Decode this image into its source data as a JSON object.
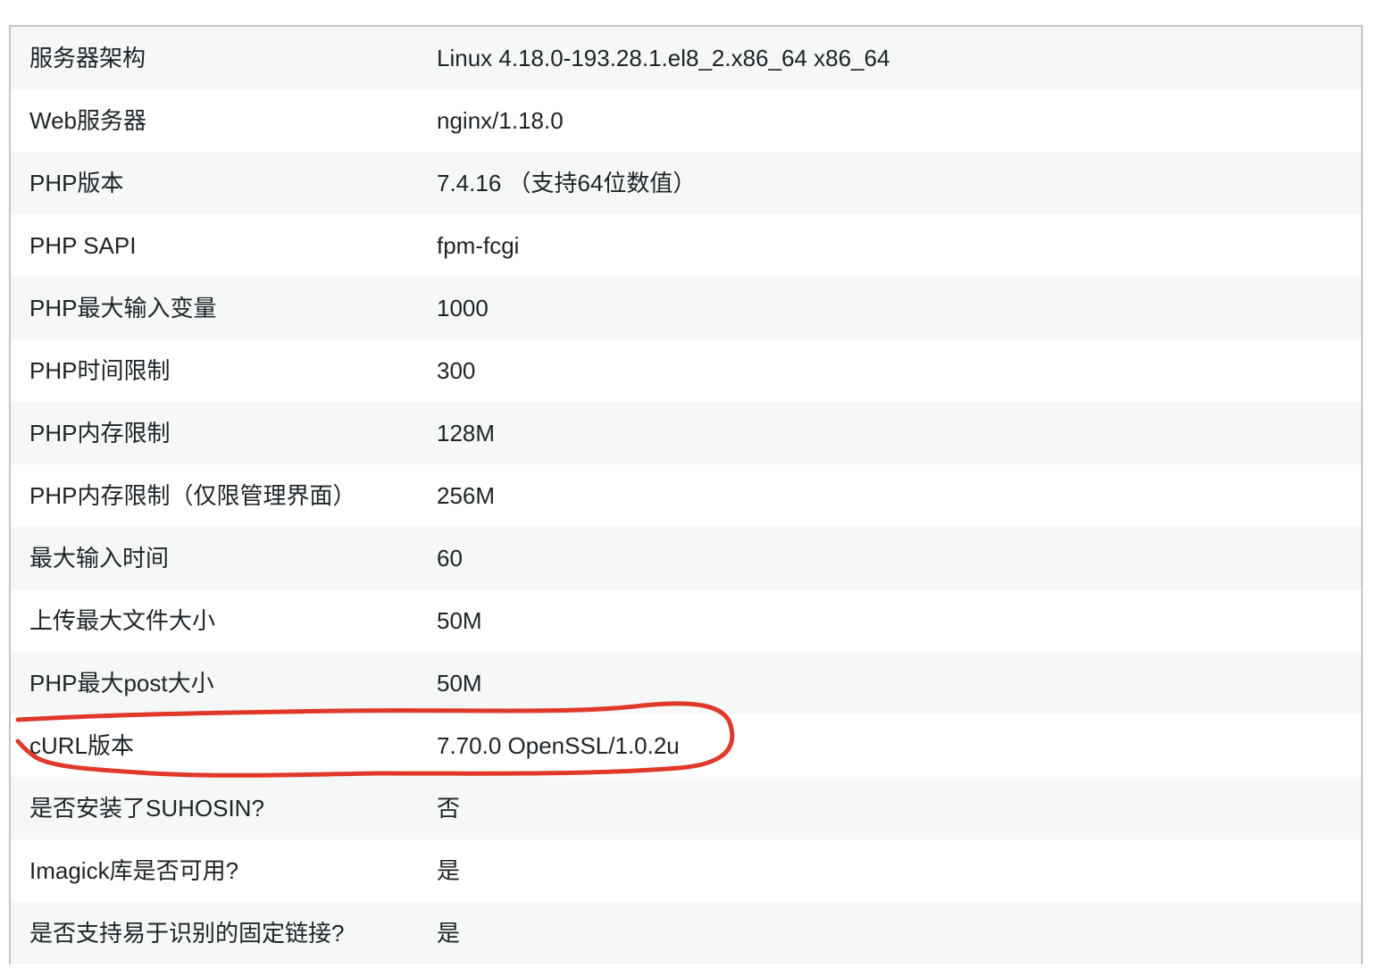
{
  "annotation_color": "#e0392b",
  "rows": [
    {
      "label": "服务器架构",
      "value": "Linux 4.18.0-193.28.1.el8_2.x86_64 x86_64"
    },
    {
      "label": "Web服务器",
      "value": "nginx/1.18.0"
    },
    {
      "label": "PHP版本",
      "value": "7.4.16 （支持64位数值）"
    },
    {
      "label": "PHP SAPI",
      "value": "fpm-fcgi"
    },
    {
      "label": "PHP最大输入变量",
      "value": "1000"
    },
    {
      "label": "PHP时间限制",
      "value": "300"
    },
    {
      "label": "PHP内存限制",
      "value": "128M"
    },
    {
      "label": "PHP内存限制（仅限管理界面）",
      "value": "256M"
    },
    {
      "label": "最大输入时间",
      "value": "60"
    },
    {
      "label": "上传最大文件大小",
      "value": "50M"
    },
    {
      "label": "PHP最大post大小",
      "value": "50M"
    },
    {
      "label": "cURL版本",
      "value": "7.70.0 OpenSSL/1.0.2u"
    },
    {
      "label": "是否安装了SUHOSIN?",
      "value": "否"
    },
    {
      "label": "Imagick库是否可用?",
      "value": "是"
    },
    {
      "label": "是否支持易于识别的固定链接?",
      "value": "是"
    }
  ]
}
